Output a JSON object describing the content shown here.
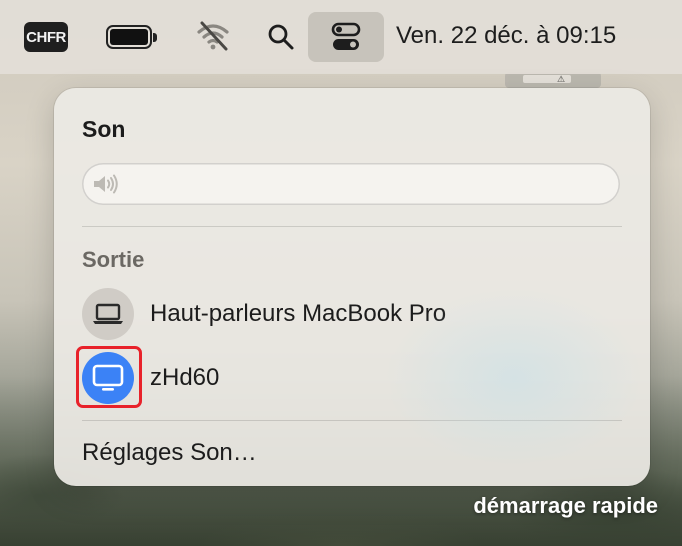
{
  "menubar": {
    "input_source": "CHFR",
    "battery_icon": "battery-icon",
    "wifi_icon": "wifi-off-icon",
    "search_icon": "search-icon",
    "control_center_icon": "control-center-icon",
    "clock": "Ven. 22 déc. à 09:15"
  },
  "sound_panel": {
    "title": "Son",
    "volume": {
      "icon": "speaker-icon",
      "level": 0
    },
    "output_section_label": "Sortie",
    "devices": [
      {
        "label": "Haut-parleurs MacBook Pro",
        "icon": "laptop-icon",
        "selected": false
      },
      {
        "label": "zHd60",
        "icon": "display-icon",
        "selected": true
      }
    ],
    "settings_link": "Réglages Son…"
  },
  "wallpaper_caption": "démarrage rapide",
  "colors": {
    "selected_device": "#3b82f6",
    "highlight_box": "#e8222a"
  }
}
